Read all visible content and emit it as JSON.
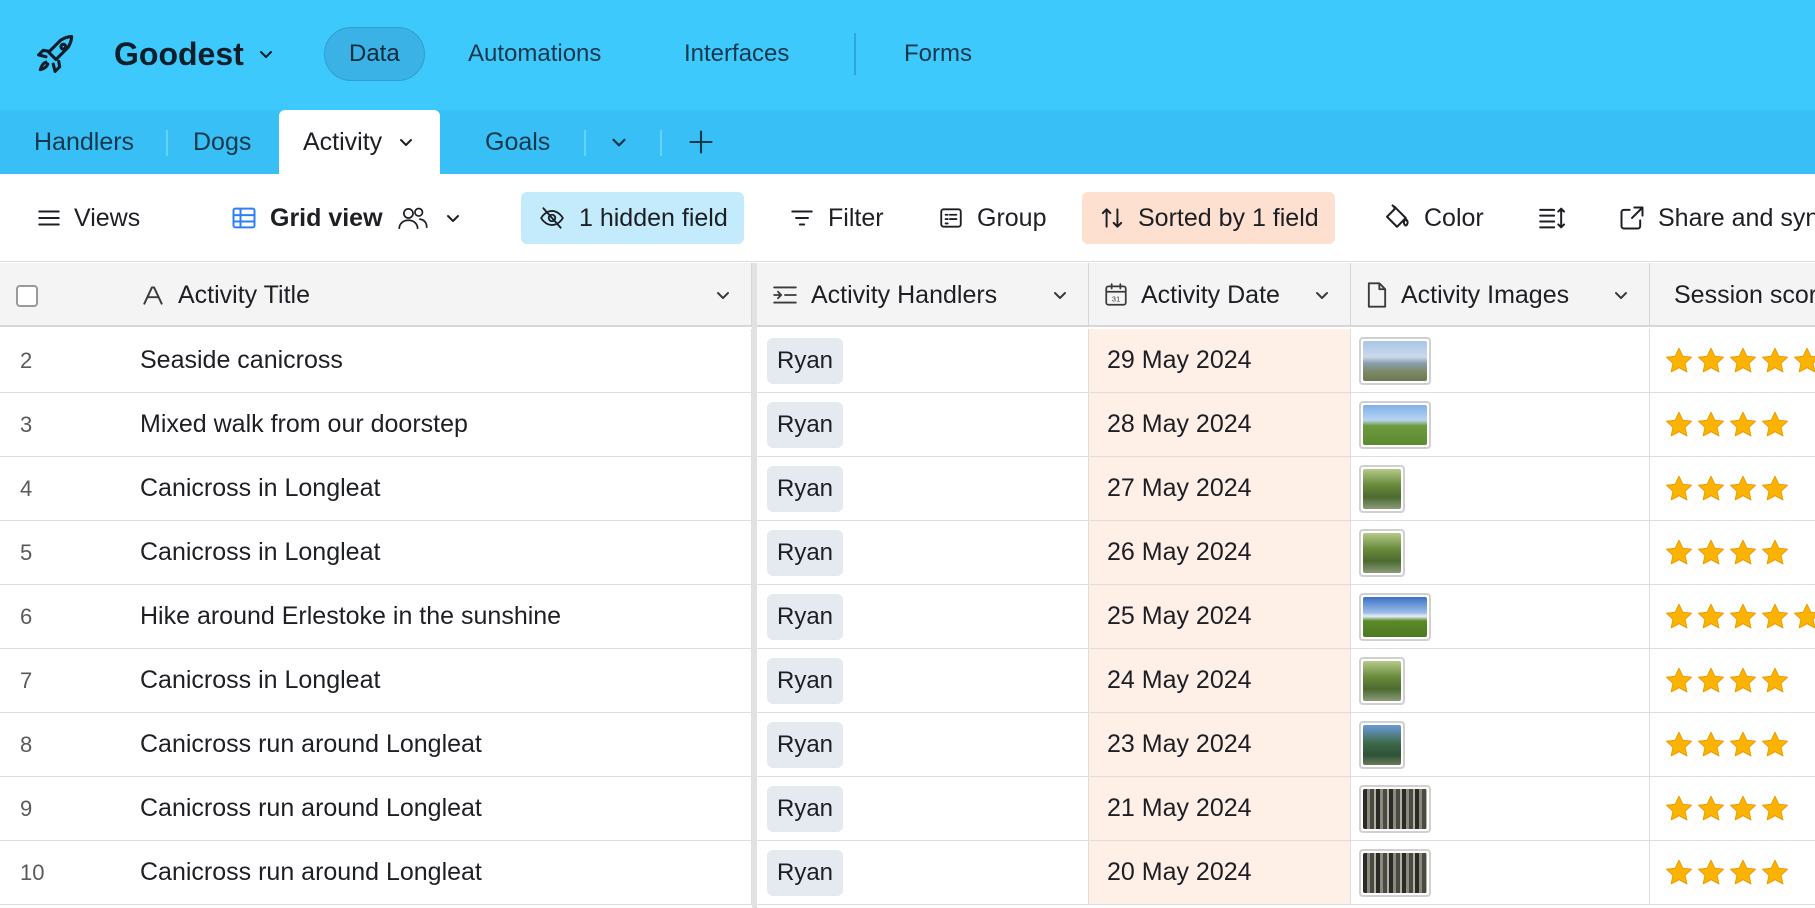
{
  "app": {
    "base_name": "Goodest",
    "nav": [
      "Data",
      "Automations",
      "Interfaces",
      "Forms"
    ],
    "active_nav": "Data"
  },
  "tables": {
    "tabs": [
      "Handlers",
      "Dogs",
      "Activity",
      "Goals"
    ],
    "active": "Activity"
  },
  "toolbar": {
    "views_label": "Views",
    "view_name": "Grid view",
    "hidden_fields": "1 hidden field",
    "filter": "Filter",
    "group": "Group",
    "sorted": "Sorted by 1 field",
    "color": "Color",
    "share": "Share and sync"
  },
  "grid": {
    "columns": {
      "title": "Activity Title",
      "handlers": "Activity Handlers",
      "date": "Activity Date",
      "images": "Activity Images",
      "session": "Session score"
    },
    "rows": [
      {
        "num": "2",
        "title": "Seaside canicross",
        "handler": "Ryan",
        "date": "29 May 2024",
        "image": "seaside",
        "stars": 5
      },
      {
        "num": "3",
        "title": "Mixed walk from our doorstep",
        "handler": "Ryan",
        "date": "28 May 2024",
        "image": "field",
        "stars": 4
      },
      {
        "num": "4",
        "title": "Canicross in Longleat",
        "handler": "Ryan",
        "date": "27 May 2024",
        "image": "woods",
        "stars": 4
      },
      {
        "num": "5",
        "title": "Canicross in Longleat",
        "handler": "Ryan",
        "date": "26 May 2024",
        "image": "woods",
        "stars": 4
      },
      {
        "num": "6",
        "title": "Hike around Erlestoke in the sunshine",
        "handler": "Ryan",
        "date": "25 May 2024",
        "image": "meadow",
        "stars": 5
      },
      {
        "num": "7",
        "title": "Canicross in Longleat",
        "handler": "Ryan",
        "date": "24 May 2024",
        "image": "woods",
        "stars": 4
      },
      {
        "num": "8",
        "title": "Canicross run around Longleat",
        "handler": "Ryan",
        "date": "23 May 2024",
        "image": "pine",
        "stars": 4
      },
      {
        "num": "9",
        "title": "Canicross run around Longleat",
        "handler": "Ryan",
        "date": "21 May 2024",
        "image": "forest",
        "stars": 4
      },
      {
        "num": "10",
        "title": "Canicross run around Longleat",
        "handler": "Ryan",
        "date": "20 May 2024",
        "image": "forest",
        "stars": 4
      }
    ]
  },
  "colors": {
    "appbar": "#3ec9fd",
    "tabbar": "#38bff5",
    "hidden_field_bg": "#c3ebfc",
    "sorted_bg": "#fde0cf",
    "sorted_column_bg": "#fef0e6",
    "star": "#fcb400"
  }
}
